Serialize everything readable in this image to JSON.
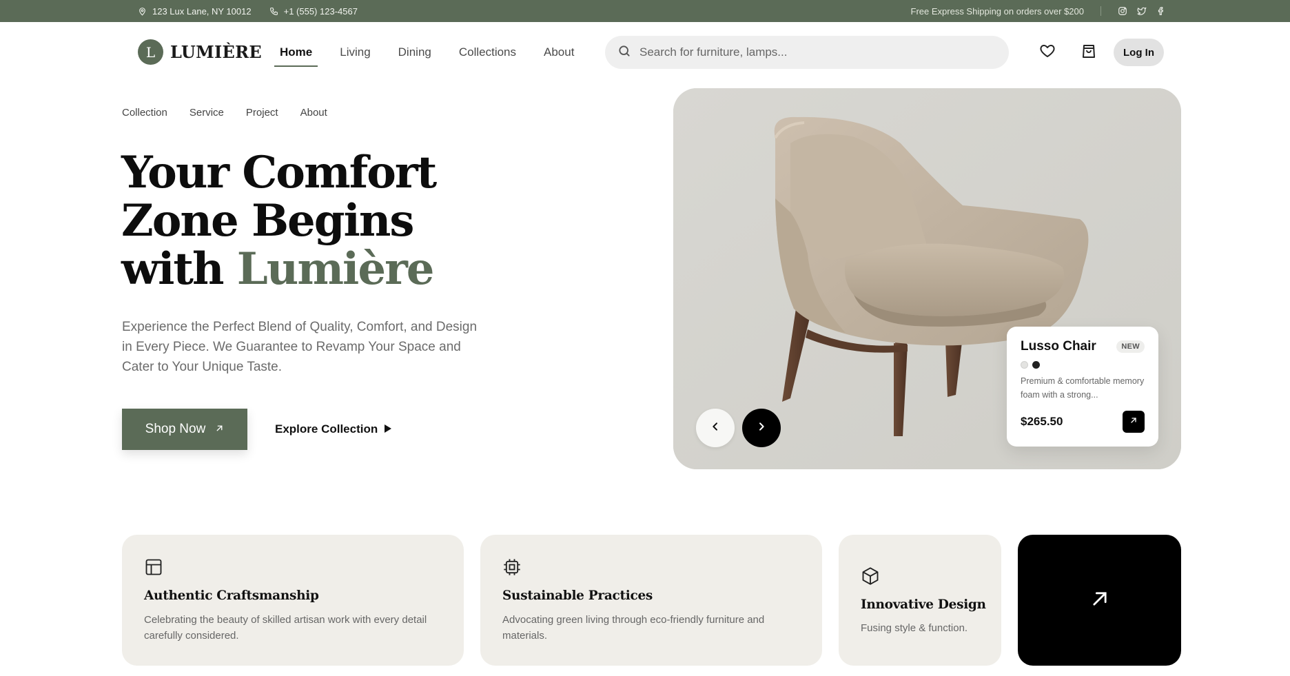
{
  "topbar": {
    "address": "123 Lux Lane, NY 10012",
    "phone": "+1 (555) 123-4567",
    "shipping": "Free Express Shipping on orders over $200",
    "socials": [
      "instagram-icon",
      "twitter-icon",
      "facebook-icon"
    ]
  },
  "brand": {
    "mark": "L",
    "name": "LUMIÈRE",
    "color": "#5b6b57"
  },
  "nav": {
    "items": [
      {
        "label": "Home",
        "active": true
      },
      {
        "label": "Living"
      },
      {
        "label": "Dining"
      },
      {
        "label": "Collections"
      },
      {
        "label": "About"
      }
    ]
  },
  "search": {
    "placeholder": "Search for furniture, lamps..."
  },
  "header_actions": {
    "wishlist_icon": "heart-icon",
    "cart_icon": "shopping-bag-icon",
    "login_label": "Log In"
  },
  "subnav": {
    "items": [
      "Collection",
      "Service",
      "Project",
      "About"
    ]
  },
  "hero": {
    "title_line1": "Your Comfort",
    "title_line2": "Zone Begins",
    "title_line3_prefix": "with ",
    "title_line3_accent": "Lumière",
    "description": "Experience the Perfect Blend of Quality, Comfort, and Design in Every Piece. We Guarantee to Revamp Your Space and Cater to Your Unique Taste.",
    "shop_label": "Shop Now",
    "explore_label": "Explore Collection"
  },
  "product": {
    "name": "Lusso Chair",
    "badge": "NEW",
    "swatches": [
      "#e3e3e1",
      "#222222"
    ],
    "description": "Premium & comfortable memory foam with a strong...",
    "price": "$265.50"
  },
  "features": [
    {
      "icon": "layout-icon",
      "title": "Authentic Craftsmanship",
      "description": "Celebrating the beauty of skilled artisan work with every detail carefully considered."
    },
    {
      "icon": "chip-icon",
      "title": "Sustainable Practices",
      "description": "Advocating green living through eco-friendly furniture and materials."
    },
    {
      "icon": "cube-icon",
      "title": "Innovative Design",
      "description": "Fusing style & function."
    }
  ]
}
